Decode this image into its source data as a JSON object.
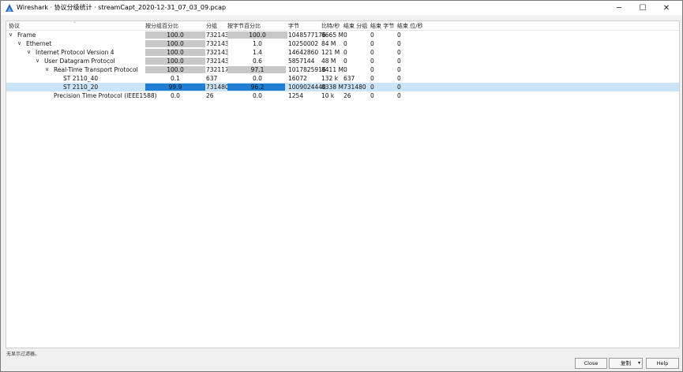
{
  "window": {
    "title": "Wireshark · 协议分级统计 · streamCapt_2020-12-31_07_03_09.pcap",
    "min_icon": "─",
    "max_icon": "☐",
    "close_icon": "✕"
  },
  "columns": {
    "protocol": "协议",
    "pct_packets": "按分组百分比",
    "packets": "分组",
    "pct_bytes": "按字节百分比",
    "bytes": "字节",
    "bits_per_sec": "比特/秒",
    "end_packets": "结束 分组",
    "end_bytes": "结束 字节",
    "end_bits_per_sec": "结束 位/秒"
  },
  "rows": [
    {
      "protocol": "Frame",
      "expander": "∨",
      "pct_packets": "100.0",
      "pct_packets_value": 100.0,
      "packets": "732143",
      "pct_bytes": "100.0",
      "pct_bytes_value": 100.0,
      "bytes": "1048577176",
      "bits_per_sec": "8665 M",
      "end_packets": "0",
      "end_bytes": "0",
      "end_bits_per_sec": "0",
      "selected": false
    },
    {
      "protocol": "Ethernet",
      "expander": "∨",
      "pct_packets": "100.0",
      "pct_packets_value": 100.0,
      "packets": "732143",
      "pct_bytes": "1.0",
      "pct_bytes_value": 1.0,
      "bytes": "10250002",
      "bits_per_sec": "84 M",
      "end_packets": "0",
      "end_bytes": "0",
      "end_bits_per_sec": "0",
      "selected": false
    },
    {
      "protocol": "Internet Protocol Version 4",
      "expander": "∨",
      "pct_packets": "100.0",
      "pct_packets_value": 100.0,
      "packets": "732143",
      "pct_bytes": "1.4",
      "pct_bytes_value": 1.4,
      "bytes": "14642860",
      "bits_per_sec": "121 M",
      "end_packets": "0",
      "end_bytes": "0",
      "end_bits_per_sec": "0",
      "selected": false
    },
    {
      "protocol": "User Datagram Protocol",
      "expander": "∨",
      "pct_packets": "100.0",
      "pct_packets_value": 100.0,
      "packets": "732143",
      "pct_bytes": "0.6",
      "pct_bytes_value": 0.6,
      "bytes": "5857144",
      "bits_per_sec": "48 M",
      "end_packets": "0",
      "end_bytes": "0",
      "end_bits_per_sec": "0",
      "selected": false
    },
    {
      "protocol": "Real-Time Transport Protocol",
      "expander": "∨",
      "pct_packets": "100.0",
      "pct_packets_value": 100.0,
      "packets": "732117",
      "pct_bytes": "97.1",
      "pct_bytes_value": 97.1,
      "bytes": "1017825916",
      "bits_per_sec": "8411 M",
      "end_packets": "0",
      "end_bytes": "0",
      "end_bits_per_sec": "0",
      "selected": false
    },
    {
      "protocol": "ST 2110_40",
      "expander": "",
      "pct_packets": "0.1",
      "pct_packets_value": 0.1,
      "packets": "637",
      "pct_bytes": "0.0",
      "pct_bytes_value": 0.0,
      "bytes": "16072",
      "bits_per_sec": "132 k",
      "end_packets": "637",
      "end_bytes": "0",
      "end_bits_per_sec": "0",
      "selected": false
    },
    {
      "protocol": "ST 2110_20",
      "expander": "",
      "pct_packets": "99.9",
      "pct_packets_value": 99.9,
      "packets": "731480",
      "pct_bytes": "96.2",
      "pct_bytes_value": 96.2,
      "bytes": "1009024440",
      "bits_per_sec": "8338 M",
      "end_packets": "731480",
      "end_bytes": "0",
      "end_bits_per_sec": "0",
      "selected": true
    },
    {
      "protocol": "Precision Time Protocol (IEEE1588)",
      "expander": "",
      "pct_packets": "0.0",
      "pct_packets_value": 0.0,
      "packets": "26",
      "pct_bytes": "0.0",
      "pct_bytes_value": 0.0,
      "bytes": "1254",
      "bits_per_sec": "10 k",
      "end_packets": "26",
      "end_bytes": "0",
      "end_bits_per_sec": "0",
      "selected": false
    }
  ],
  "status": "无显示过滤器。",
  "buttons": {
    "close": "Close",
    "copy": "复制",
    "copy_caret": "▾",
    "help": "Help"
  },
  "colors": {
    "bar_gray": "#c8c8c8",
    "bar_selected": "#1f7fd4",
    "row_selected": "#cce4f7"
  }
}
